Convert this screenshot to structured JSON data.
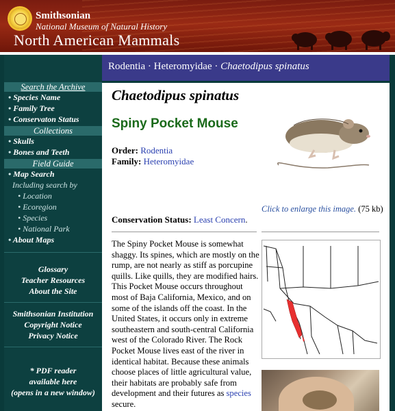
{
  "header": {
    "institution": "Smithsonian",
    "museum": "National Museum of Natural History",
    "title": "North American Mammals"
  },
  "sidebar": {
    "search_archive": "Search the Archive",
    "search_items": [
      "Species Name",
      "Family Tree",
      "Conservaton Status"
    ],
    "collections": "Collections",
    "collection_items": [
      "Skulls",
      "Bones and Teeth"
    ],
    "field_guide": "Field Guide",
    "map_search": "Map Search",
    "including": "Including search by",
    "including_items": [
      "Location",
      "Ecoregion",
      "Species",
      "National Park"
    ],
    "about_maps": "About Maps",
    "links1": [
      "Glossary",
      "Teacher Resources",
      "About the Site"
    ],
    "links2": [
      "Smithsonian Institution",
      "Copyright Notice",
      "Privacy Notice"
    ],
    "pdf_note": [
      "* PDF reader",
      "available here",
      "(opens in a new window)"
    ]
  },
  "breadcrumb": {
    "order": "Rodentia",
    "sep": "·",
    "family": "Heteromyidae",
    "species": "Chaetodipus spinatus"
  },
  "main": {
    "scientific_name": "Chaetodipus spinatus",
    "common_name": "Spiny Pocket Mouse",
    "order_label": "Order:",
    "order_value": "Rodentia",
    "family_label": "Family:",
    "family_value": "Heteromyidae",
    "enlarge_link": "Click to enlarge this image.",
    "enlarge_size": "(75 kb)",
    "conservation_label": "Conservation Status:",
    "conservation_value": "Least Concern",
    "description_pre": "The Spiny Pocket Mouse is somewhat shaggy. Its spines, which are mostly on the rump, are not nearly as stiff as porcupine quills. Like quills, they are modified hairs. This Pocket Mouse occurs throughout most of Baja California, Mexico, and on some of the islands off the coast. In the United States, it occurs only in extreme southeastern and south-central California west of the Colorado River. The Rock Pocket Mouse lives east of the river in identical habitat. Because these animals choose places of little agricultural value, their habitats are probably safe from development and their futures as",
    "description_link": "species",
    "description_post": "secure."
  },
  "colors": {
    "header_red": "#8a2010",
    "sidebar_bg": "#0d4040",
    "crumb_bg": "#3a3a8a",
    "common_name_green": "#1a6a1a",
    "link_blue": "#2a40b0"
  }
}
